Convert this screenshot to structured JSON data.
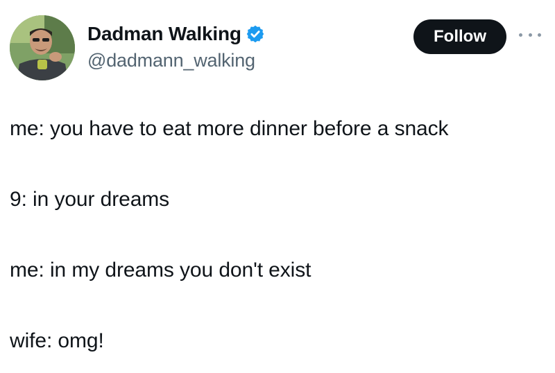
{
  "author": {
    "display_name": "Dadman Walking",
    "handle": "@dadmann_walking",
    "verified": true,
    "avatar_icon": "profile-photo"
  },
  "actions": {
    "follow_label": "Follow",
    "more_icon": "more-horizontal-icon"
  },
  "tweet": {
    "lines": [
      "me: you have to eat more dinner before a snack",
      "9: in your dreams",
      "me: in my dreams you don't exist",
      "wife: omg!"
    ]
  },
  "colors": {
    "text": "#0f1419",
    "secondary": "#536471",
    "verified_blue": "#1d9bf0",
    "follow_bg": "#0f1419",
    "follow_text": "#ffffff"
  }
}
